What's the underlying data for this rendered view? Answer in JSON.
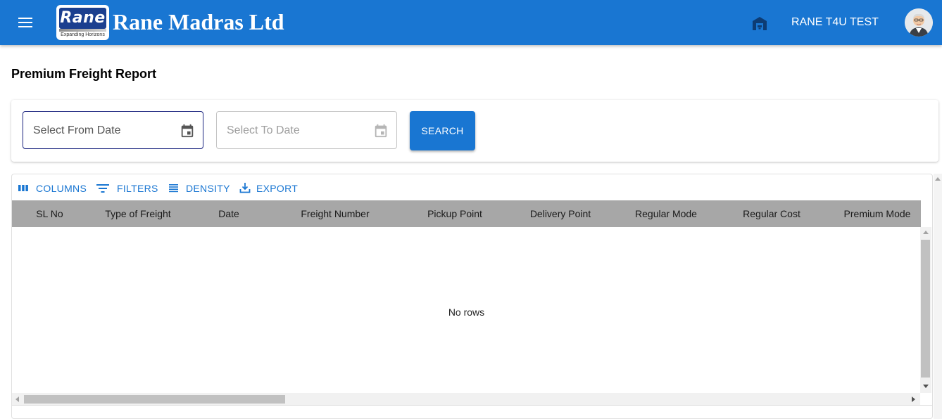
{
  "appbar": {
    "company_name": "Rane Madras Ltd",
    "logo_text": "Rane",
    "logo_tagline": "Expanding Horizons",
    "user_name": "RANE T4U TEST",
    "icons": [
      "menu-icon",
      "warehouse-icon",
      "avatar-icon"
    ],
    "color": "#1976d2"
  },
  "page": {
    "title": "Premium Freight Report"
  },
  "filters": {
    "from_date_placeholder": "Select From Date",
    "to_date_placeholder": "Select To Date",
    "search_label": "SEARCH"
  },
  "grid": {
    "toolbar": {
      "columns_label": "COLUMNS",
      "filters_label": "FILTERS",
      "density_label": "DENSITY",
      "export_label": "EXPORT"
    },
    "columns": [
      "SL No",
      "Type of Freight",
      "Date",
      "Freight Number",
      "Pickup Point",
      "Delivery Point",
      "Regular Mode",
      "Regular Cost",
      "Premium Mode"
    ],
    "empty_text": "No rows",
    "header_color": "#a7a7a7"
  }
}
